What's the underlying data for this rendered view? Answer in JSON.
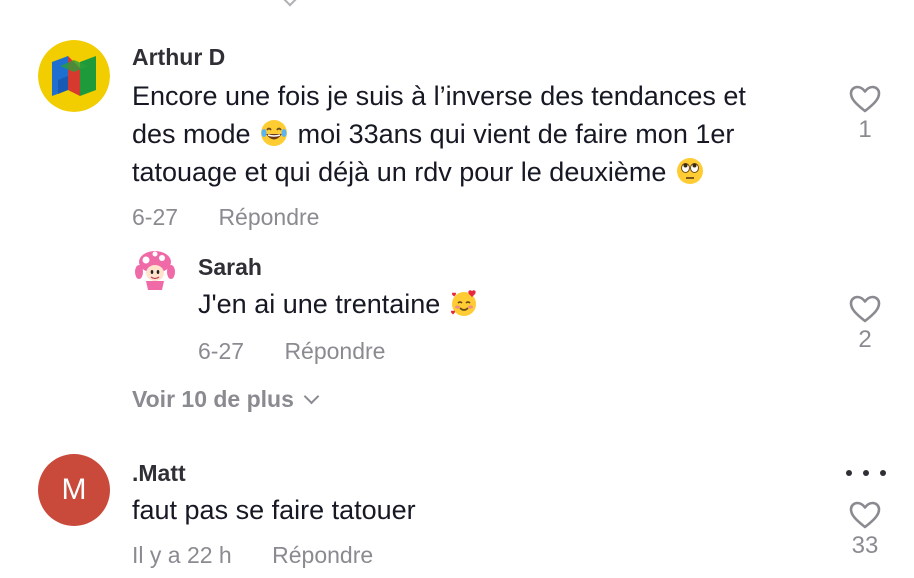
{
  "comments": [
    {
      "author": "Arthur D",
      "avatar_icon": "n64-logo-icon",
      "lines": [
        "Encore une fois je suis à l’inverse des tendances et",
        "des mode",
        "moi 33ans qui vient de faire mon 1er",
        "tatouage et qui déjà un rdv pour le deuxième"
      ],
      "emojis": [
        "laughing-tears-emoji",
        "eye-roll-emoji"
      ],
      "date": "6-27",
      "reply_label": "Répondre",
      "likes": "1"
    },
    {
      "author": "Sarah",
      "avatar_icon": "toadette-icon",
      "text": "J'en ai une trentaine",
      "emoji": "smiling-hearts-emoji",
      "date": "6-27",
      "reply_label": "Répondre",
      "likes": "2"
    },
    {
      "author": ".Matt",
      "avatar_letter": "M",
      "avatar_color": "#c94a3b",
      "text": "faut pas se faire tatouer",
      "date": "Il y a 22 h",
      "reply_label": "Répondre",
      "likes": "33"
    }
  ],
  "more_replies_label": "Voir 10 de plus",
  "colors": {
    "text": "#161823",
    "secondary": "#8a8b91",
    "author": "#2f2f35"
  }
}
